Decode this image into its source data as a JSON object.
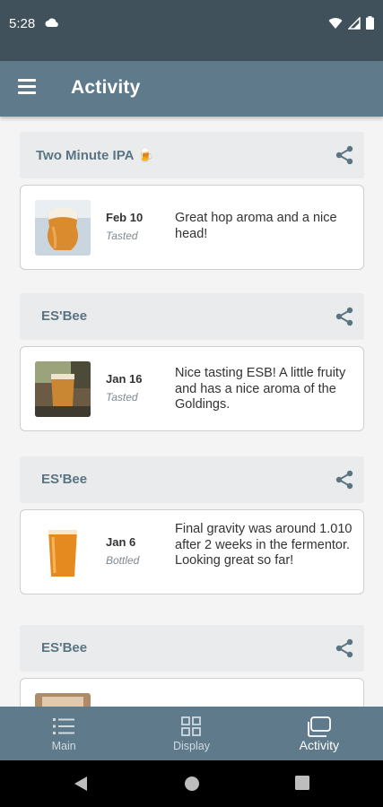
{
  "status_bar": {
    "time": "5:28"
  },
  "app_bar": {
    "title": "Activity"
  },
  "feed": [
    {
      "title": "Two Minute IPA 🍺",
      "date": "Feb 10",
      "status": "Tasted",
      "text": "Great hop aroma and a nice head!",
      "image": "tulip-glass-ipa"
    },
    {
      "title": "ES'Bee",
      "date": "Jan 16",
      "status": "Tasted",
      "text": "Nice tasting ESB! A little fruity and has a nice aroma of the Goldings.",
      "image": "glass-esb-outdoor"
    },
    {
      "title": "ES'Bee",
      "date": "Jan 6",
      "status": "Bottled",
      "text": "Final gravity was around 1.010 after 2 weeks in the fermentor. Looking great so far!",
      "image": "pint-glass"
    },
    {
      "title": "ES'Bee",
      "date": "",
      "status": "",
      "text": "",
      "image": "partial-photo"
    }
  ],
  "bottom_nav": {
    "items": [
      {
        "label": "Main",
        "icon": "list-icon"
      },
      {
        "label": "Display",
        "icon": "grid-icon"
      },
      {
        "label": "Activity",
        "icon": "activity-icon",
        "active": true
      }
    ]
  },
  "colors": {
    "app_bar": "#5f7a8a",
    "status_bar": "#41515b",
    "header_text": "#5a7482"
  }
}
